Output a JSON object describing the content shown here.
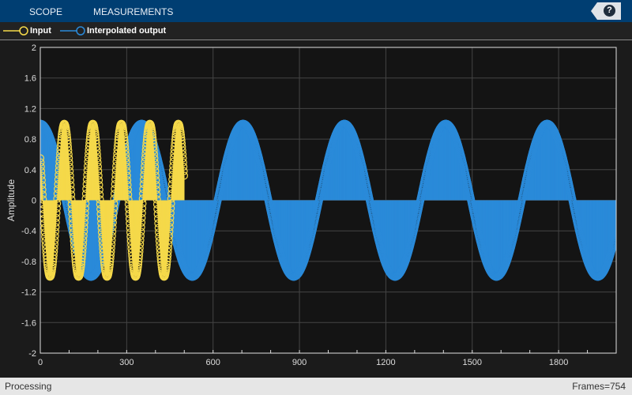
{
  "toolbar": {
    "tabs": [
      "SCOPE",
      "MEASUREMENTS"
    ],
    "help_label": "?"
  },
  "status": {
    "left": "Processing",
    "right": "Frames=754"
  },
  "colors": {
    "input": "#f5d94a",
    "output": "#2a8ad9",
    "axes_bg": "#141414",
    "grid": "#444444"
  },
  "chart_data": {
    "type": "stem",
    "ylabel": "Amplitude",
    "xlabel": "",
    "xlim": [
      0,
      2000
    ],
    "ylim": [
      -2,
      2
    ],
    "xticks": [
      0,
      300,
      600,
      900,
      1200,
      1500,
      1800
    ],
    "yticks": [
      -2,
      -1.6,
      -1.2,
      -0.8,
      -0.4,
      0,
      0.4,
      0.8,
      1.2,
      1.6,
      2
    ],
    "xtick_labels": [
      "0",
      "300",
      "600",
      "900",
      "1200",
      "1500",
      "1800"
    ],
    "ytick_labels": [
      "-2",
      "-1.6",
      "-1.2",
      "-0.8",
      "-0.4",
      "0",
      "0.4",
      "0.8",
      "1.2",
      "1.6",
      "2"
    ],
    "grid": true,
    "legend_position": "top",
    "series": [
      {
        "name": "Input",
        "samples": 500,
        "waveform": "sine",
        "amplitude": 1,
        "period": 99,
        "phase": 2.56,
        "first_value": 0.55,
        "last_value": 0.33
      },
      {
        "name": "Interpolated output",
        "samples": 2000,
        "waveform": "cosine",
        "amplitude": 1,
        "period": 352,
        "phase": 0,
        "first_value": 1,
        "last_value": -0.25
      }
    ]
  }
}
